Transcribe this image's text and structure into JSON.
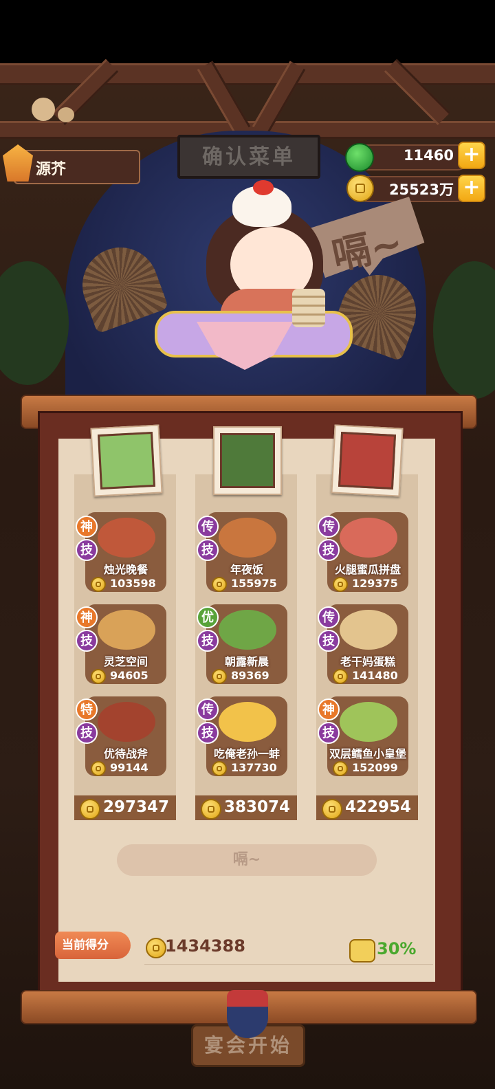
{
  "player": {
    "name": "源芥"
  },
  "title_plate": "确认菜单",
  "currencies": {
    "jade": "11460",
    "coins": "25523万",
    "plus": "+"
  },
  "speech": "嗝~",
  "columns": [
    {
      "total": "297347",
      "dishes": [
        {
          "tier": "神",
          "skill": "技",
          "name": "烛光晚餐",
          "score": "103598"
        },
        {
          "tier": "神",
          "skill": "技",
          "name": "灵芝空间",
          "score": "94605"
        },
        {
          "tier": "特",
          "skill": "技",
          "name": "优待战斧",
          "score": "99144"
        }
      ]
    },
    {
      "total": "383074",
      "dishes": [
        {
          "tier": "传",
          "skill": "技",
          "name": "年夜饭",
          "score": "155975"
        },
        {
          "tier": "优",
          "skill": "技",
          "name": "朝露新晨",
          "score": "89369"
        },
        {
          "tier": "传",
          "skill": "技",
          "name": "吃俺老孙一蚌",
          "score": "137730"
        }
      ]
    },
    {
      "total": "422954",
      "dishes": [
        {
          "tier": "传",
          "skill": "技",
          "name": "火腿蜜瓜拼盘",
          "score": "129375"
        },
        {
          "tier": "传",
          "skill": "技",
          "name": "老干妈蛋糕",
          "score": "141480"
        },
        {
          "tier": "神",
          "skill": "技",
          "name": "双层鳕鱼小皇堡",
          "score": "152099"
        }
      ]
    }
  ],
  "burp_button": "嗝~",
  "current_score_label": "当前得分",
  "current_score": "1434388",
  "bonus": "30%",
  "start_button": "宴会开始"
}
